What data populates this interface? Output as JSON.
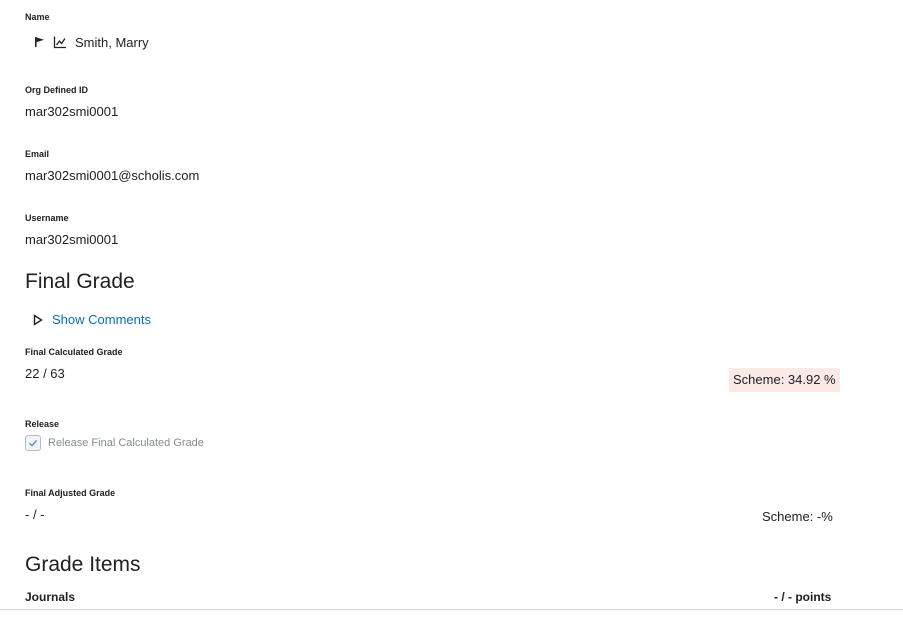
{
  "profile": {
    "name_label": "Name",
    "name": "Smith, Marry",
    "org_id_label": "Org Defined ID",
    "org_id": "mar302smi0001",
    "email_label": "Email",
    "email": "mar302smi0001@scholis.com",
    "username_label": "Username",
    "username": "mar302smi0001"
  },
  "final_grade": {
    "heading": "Final Grade",
    "show_comments": "Show Comments",
    "calculated_label": "Final Calculated Grade",
    "calculated_value": "22 / 63",
    "calculated_scheme": "Scheme: 34.92 %",
    "release_label": "Release",
    "release_checkbox_label": "Release Final Calculated Grade",
    "release_checked": true,
    "adjusted_label": "Final Adjusted Grade",
    "adjusted_value": "- / -",
    "adjusted_scheme": "Scheme: -%"
  },
  "grade_items": {
    "heading": "Grade Items",
    "rows": [
      {
        "name": "Journals",
        "score": "- / - points"
      }
    ]
  },
  "icons": {
    "flag": "flag-icon",
    "stats": "line-chart-icon",
    "toggle": "triangle-right-icon",
    "check": "checkmark-icon"
  },
  "colors": {
    "link": "#006fbf",
    "scheme_highlight": "#fbe9e5"
  }
}
